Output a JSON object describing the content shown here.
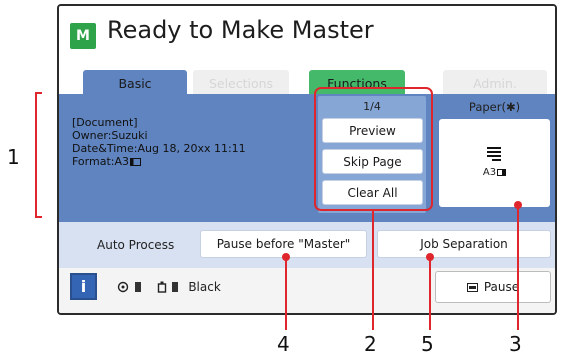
{
  "title": "Ready to Make Master",
  "title_icon": "master-icon",
  "tabs": [
    {
      "label": "Basic"
    },
    {
      "label": "Selections"
    },
    {
      "label": "Functions"
    },
    {
      "label": "Admin."
    }
  ],
  "document": {
    "heading": "[Document]",
    "owner": "Owner:Suzuki",
    "datetime": "Date&Time:Aug 18, 20xx 11:11",
    "format": "Format:A3"
  },
  "page_group": {
    "counter": "1/4",
    "preview": "Preview",
    "skip_page": "Skip Page",
    "clear_all": "Clear All"
  },
  "paper": {
    "label": "Paper(✱)",
    "size": "A3"
  },
  "auto_process": {
    "label": "Auto Process",
    "pause_before_master": "Pause before \"Master\"",
    "job_separation": "Job Separation"
  },
  "status": {
    "ink_color": "Black",
    "pause": "Pause"
  },
  "callouts": [
    "1",
    "2",
    "3",
    "4",
    "5"
  ],
  "colors": {
    "accent_blue": "#5f84bf",
    "functions_green": "#44b96a",
    "callout_red": "#e0262d"
  }
}
